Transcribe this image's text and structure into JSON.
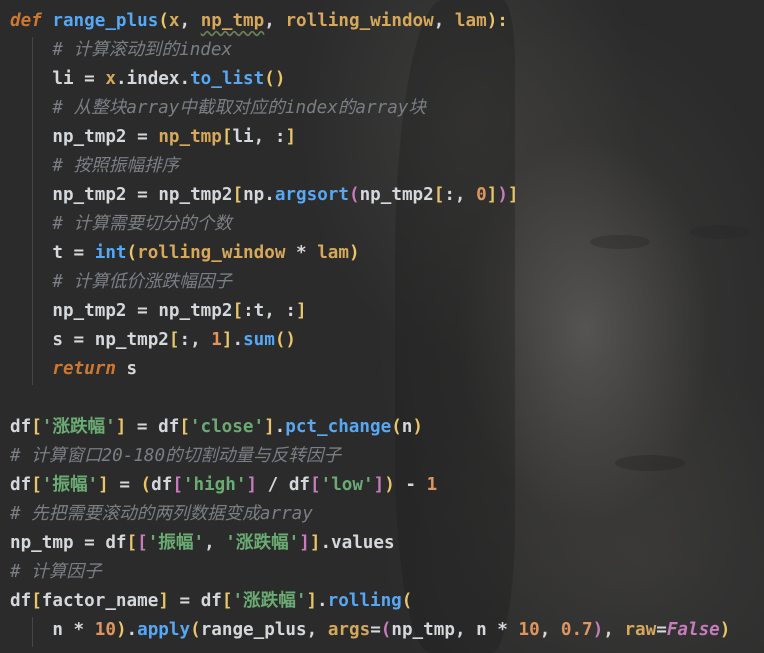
{
  "colors": {
    "keyword": "#cc7832",
    "function": "#56a8f5",
    "parameter": "#d6a85c",
    "string": "#6aab73",
    "number": "#e0955f",
    "comment": "#7a7e85",
    "identifier": "#d4d8dc",
    "constant": "#c77dbb",
    "background": "#2b2b2b"
  },
  "code_lines": [
    {
      "tokens": [
        {
          "t": "def",
          "c": "kw"
        },
        {
          "t": " ",
          "c": "id"
        },
        {
          "t": "range_plus",
          "c": "fn"
        },
        {
          "t": "(",
          "c": "lp"
        },
        {
          "t": "x",
          "c": "param"
        },
        {
          "t": ", ",
          "c": "punc"
        },
        {
          "t": "np_tmp",
          "c": "param-u"
        },
        {
          "t": ", ",
          "c": "punc"
        },
        {
          "t": "rolling_window",
          "c": "param"
        },
        {
          "t": ", ",
          "c": "punc"
        },
        {
          "t": "lam",
          "c": "param"
        },
        {
          "t": "):",
          "c": "lp"
        }
      ]
    },
    {
      "tokens": [
        {
          "t": "    ",
          "c": "id"
        },
        {
          "t": "# 计算滚动到的index",
          "c": "comment"
        }
      ]
    },
    {
      "tokens": [
        {
          "t": "    ",
          "c": "id"
        },
        {
          "t": "li",
          "c": "id"
        },
        {
          "t": " = ",
          "c": "op"
        },
        {
          "t": "x",
          "c": "param"
        },
        {
          "t": ".index.",
          "c": "id"
        },
        {
          "t": "to_list",
          "c": "call"
        },
        {
          "t": "()",
          "c": "lp"
        }
      ]
    },
    {
      "tokens": [
        {
          "t": "    ",
          "c": "id"
        },
        {
          "t": "# 从整块array中截取对应的index的array块",
          "c": "comment"
        }
      ]
    },
    {
      "tokens": [
        {
          "t": "    ",
          "c": "id"
        },
        {
          "t": "np_tmp2",
          "c": "id"
        },
        {
          "t": " = ",
          "c": "op"
        },
        {
          "t": "np_tmp",
          "c": "param"
        },
        {
          "t": "[",
          "c": "lp"
        },
        {
          "t": "li, :",
          "c": "id"
        },
        {
          "t": "]",
          "c": "lp"
        }
      ]
    },
    {
      "tokens": [
        {
          "t": "    ",
          "c": "id"
        },
        {
          "t": "# 按照振幅排序",
          "c": "comment"
        }
      ]
    },
    {
      "tokens": [
        {
          "t": "    ",
          "c": "id"
        },
        {
          "t": "np_tmp2",
          "c": "id"
        },
        {
          "t": " = ",
          "c": "op"
        },
        {
          "t": "np_tmp2",
          "c": "id"
        },
        {
          "t": "[",
          "c": "lp"
        },
        {
          "t": "np.",
          "c": "id"
        },
        {
          "t": "argsort",
          "c": "call"
        },
        {
          "t": "(",
          "c": "b2"
        },
        {
          "t": "np_tmp2",
          "c": "id"
        },
        {
          "t": "[",
          "c": "lp"
        },
        {
          "t": ":, ",
          "c": "id"
        },
        {
          "t": "0",
          "c": "num"
        },
        {
          "t": "]",
          "c": "lp"
        },
        {
          "t": ")",
          "c": "b2"
        },
        {
          "t": "]",
          "c": "lp"
        }
      ]
    },
    {
      "tokens": [
        {
          "t": "    ",
          "c": "id"
        },
        {
          "t": "# 计算需要切分的个数",
          "c": "comment"
        }
      ]
    },
    {
      "tokens": [
        {
          "t": "    ",
          "c": "id"
        },
        {
          "t": "t",
          "c": "id"
        },
        {
          "t": " = ",
          "c": "op"
        },
        {
          "t": "int",
          "c": "builtin"
        },
        {
          "t": "(",
          "c": "lp"
        },
        {
          "t": "rolling_window",
          "c": "param"
        },
        {
          "t": " * ",
          "c": "op"
        },
        {
          "t": "lam",
          "c": "param"
        },
        {
          "t": ")",
          "c": "lp"
        }
      ]
    },
    {
      "tokens": [
        {
          "t": "    ",
          "c": "id"
        },
        {
          "t": "# 计算低价涨跌幅因子",
          "c": "comment"
        }
      ]
    },
    {
      "tokens": [
        {
          "t": "    ",
          "c": "id"
        },
        {
          "t": "np_tmp2",
          "c": "id"
        },
        {
          "t": " = ",
          "c": "op"
        },
        {
          "t": "np_tmp2",
          "c": "id"
        },
        {
          "t": "[",
          "c": "lp"
        },
        {
          "t": ":t, :",
          "c": "id"
        },
        {
          "t": "]",
          "c": "lp"
        }
      ]
    },
    {
      "tokens": [
        {
          "t": "    ",
          "c": "id"
        },
        {
          "t": "s",
          "c": "id"
        },
        {
          "t": " = ",
          "c": "op"
        },
        {
          "t": "np_tmp2",
          "c": "id"
        },
        {
          "t": "[",
          "c": "lp"
        },
        {
          "t": ":, ",
          "c": "id"
        },
        {
          "t": "1",
          "c": "num"
        },
        {
          "t": "]",
          "c": "lp"
        },
        {
          "t": ".",
          "c": "id"
        },
        {
          "t": "sum",
          "c": "call"
        },
        {
          "t": "()",
          "c": "lp"
        }
      ]
    },
    {
      "tokens": [
        {
          "t": "    ",
          "c": "id"
        },
        {
          "t": "return",
          "c": "ret"
        },
        {
          "t": " s",
          "c": "id"
        }
      ]
    },
    {
      "tokens": [
        {
          "t": "",
          "c": "id"
        }
      ]
    },
    {
      "tokens": [
        {
          "t": "df",
          "c": "id"
        },
        {
          "t": "[",
          "c": "lp"
        },
        {
          "t": "'涨跌幅'",
          "c": "str"
        },
        {
          "t": "]",
          "c": "lp"
        },
        {
          "t": " = ",
          "c": "op"
        },
        {
          "t": "df",
          "c": "id"
        },
        {
          "t": "[",
          "c": "lp"
        },
        {
          "t": "'close'",
          "c": "str"
        },
        {
          "t": "]",
          "c": "lp"
        },
        {
          "t": ".",
          "c": "id"
        },
        {
          "t": "pct_change",
          "c": "call"
        },
        {
          "t": "(",
          "c": "lp"
        },
        {
          "t": "n",
          "c": "id"
        },
        {
          "t": ")",
          "c": "lp"
        }
      ]
    },
    {
      "tokens": [
        {
          "t": "# 计算窗口20-180的切割动量与反转因子",
          "c": "comment"
        }
      ]
    },
    {
      "tokens": [
        {
          "t": "df",
          "c": "id"
        },
        {
          "t": "[",
          "c": "lp"
        },
        {
          "t": "'振幅'",
          "c": "str"
        },
        {
          "t": "]",
          "c": "lp"
        },
        {
          "t": " = ",
          "c": "op"
        },
        {
          "t": "(",
          "c": "lp"
        },
        {
          "t": "df",
          "c": "id"
        },
        {
          "t": "[",
          "c": "b2"
        },
        {
          "t": "'high'",
          "c": "str"
        },
        {
          "t": "]",
          "c": "b2"
        },
        {
          "t": " / ",
          "c": "op"
        },
        {
          "t": "df",
          "c": "id"
        },
        {
          "t": "[",
          "c": "b2"
        },
        {
          "t": "'low'",
          "c": "str"
        },
        {
          "t": "]",
          "c": "b2"
        },
        {
          "t": ")",
          "c": "lp"
        },
        {
          "t": " - ",
          "c": "op"
        },
        {
          "t": "1",
          "c": "num"
        }
      ]
    },
    {
      "tokens": [
        {
          "t": "# 先把需要滚动的两列数据变成array",
          "c": "comment"
        }
      ]
    },
    {
      "tokens": [
        {
          "t": "np_tmp",
          "c": "id"
        },
        {
          "t": " = ",
          "c": "op"
        },
        {
          "t": "df",
          "c": "id"
        },
        {
          "t": "[",
          "c": "lp"
        },
        {
          "t": "[",
          "c": "b2"
        },
        {
          "t": "'振幅'",
          "c": "str"
        },
        {
          "t": ", ",
          "c": "punc"
        },
        {
          "t": "'涨跌幅'",
          "c": "str"
        },
        {
          "t": "]",
          "c": "b2"
        },
        {
          "t": "]",
          "c": "lp"
        },
        {
          "t": ".values",
          "c": "id"
        }
      ]
    },
    {
      "tokens": [
        {
          "t": "# 计算因子",
          "c": "comment"
        }
      ]
    },
    {
      "tokens": [
        {
          "t": "df",
          "c": "id"
        },
        {
          "t": "[",
          "c": "lp"
        },
        {
          "t": "factor_name",
          "c": "id"
        },
        {
          "t": "]",
          "c": "lp"
        },
        {
          "t": " = ",
          "c": "op"
        },
        {
          "t": "df",
          "c": "id"
        },
        {
          "t": "[",
          "c": "lp"
        },
        {
          "t": "'涨跌幅'",
          "c": "str"
        },
        {
          "t": "]",
          "c": "lp"
        },
        {
          "t": ".",
          "c": "id"
        },
        {
          "t": "rolling",
          "c": "call"
        },
        {
          "t": "(",
          "c": "lp"
        }
      ]
    },
    {
      "tokens": [
        {
          "t": "    ",
          "c": "id"
        },
        {
          "t": "n",
          "c": "id"
        },
        {
          "t": " * ",
          "c": "op"
        },
        {
          "t": "10",
          "c": "num"
        },
        {
          "t": ")",
          "c": "lp"
        },
        {
          "t": ".",
          "c": "id"
        },
        {
          "t": "apply",
          "c": "call"
        },
        {
          "t": "(",
          "c": "lp"
        },
        {
          "t": "range_plus",
          "c": "id"
        },
        {
          "t": ", ",
          "c": "punc"
        },
        {
          "t": "args",
          "c": "kwarg"
        },
        {
          "t": "=",
          "c": "op"
        },
        {
          "t": "(",
          "c": "b2"
        },
        {
          "t": "np_tmp",
          "c": "id"
        },
        {
          "t": ", ",
          "c": "punc"
        },
        {
          "t": "n",
          "c": "id"
        },
        {
          "t": " * ",
          "c": "op"
        },
        {
          "t": "10",
          "c": "num"
        },
        {
          "t": ", ",
          "c": "punc"
        },
        {
          "t": "0.7",
          "c": "num"
        },
        {
          "t": ")",
          "c": "b2"
        },
        {
          "t": ", ",
          "c": "punc"
        },
        {
          "t": "raw",
          "c": "kwarg"
        },
        {
          "t": "=",
          "c": "op"
        },
        {
          "t": "False",
          "c": "const"
        },
        {
          "t": ")",
          "c": "lp"
        }
      ]
    }
  ]
}
